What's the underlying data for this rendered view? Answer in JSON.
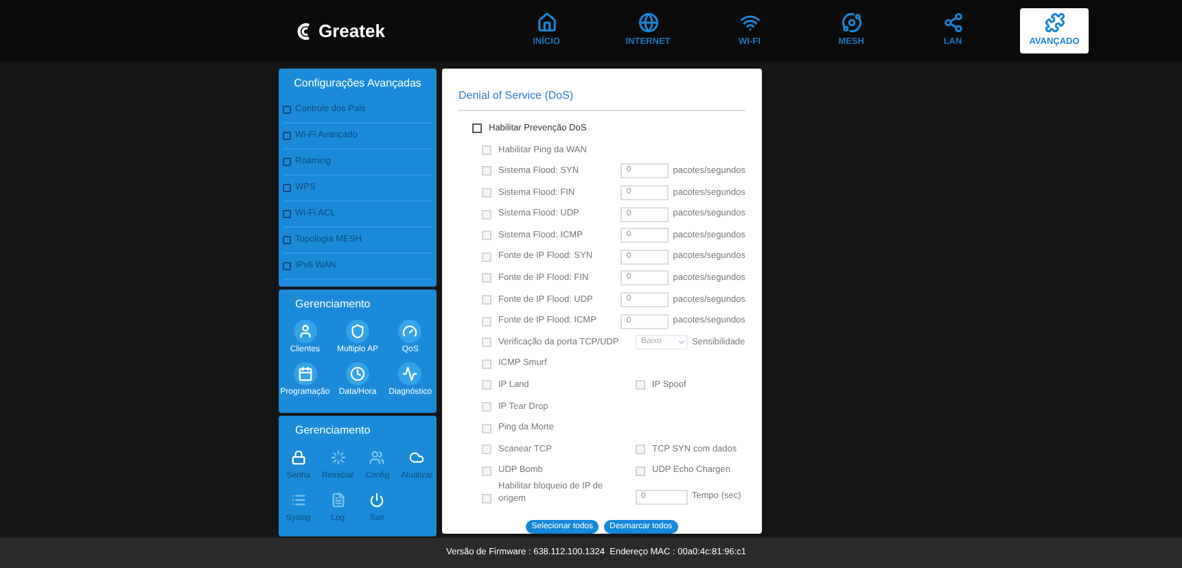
{
  "logo": "Greatek",
  "nav": [
    {
      "label": "INÍCIO",
      "selected": false
    },
    {
      "label": "INTERNET",
      "selected": false
    },
    {
      "label": "WI-FI",
      "selected": false
    },
    {
      "label": "MESH",
      "selected": false
    },
    {
      "label": "LAN",
      "selected": false
    },
    {
      "label": "AVANÇADO",
      "selected": true
    }
  ],
  "advanced_menu": {
    "title": "Configurações Avançadas",
    "items": [
      {
        "label": "Controle dos Pais",
        "disabled": true
      },
      {
        "label": "Wi-Fi Avançado",
        "disabled": true
      },
      {
        "label": "Roaming",
        "disabled": true
      },
      {
        "label": "WPS",
        "disabled": true
      },
      {
        "label": "Wi-Fi ACL",
        "disabled": true
      },
      {
        "label": "Topologia MESH",
        "disabled": true
      },
      {
        "label": "IPv6 WAN",
        "disabled": true
      }
    ]
  },
  "management_panels": [
    {
      "title": "Gerenciamento",
      "items": [
        {
          "label": "Clientes",
          "disabled": false
        },
        {
          "label": "Multiplo AP",
          "disabled": false
        },
        {
          "label": "QoS",
          "disabled": false
        },
        {
          "label": "Programação",
          "disabled": false
        },
        {
          "label": "Data/Hora",
          "disabled": false
        },
        {
          "label": "Diagnóstico",
          "disabled": false
        }
      ]
    },
    {
      "title": "Gerenciamento",
      "items": [
        {
          "label": "Senha",
          "disabled": true
        },
        {
          "label": "Reiniciar",
          "disabled": true
        },
        {
          "label": "Config",
          "disabled": true
        },
        {
          "label": "Atualizar",
          "disabled": true
        },
        {
          "label": "Syslog",
          "disabled": true
        },
        {
          "label": "Log",
          "disabled": true
        },
        {
          "label": "Sair",
          "disabled": true
        }
      ]
    }
  ],
  "dos": {
    "title": "Denial of Service (DoS)",
    "rows": [
      {
        "kind": "check",
        "label": "Habilitar Prevenção DoS",
        "checked": false,
        "disabled": false,
        "indent": false
      },
      {
        "kind": "check",
        "label": "Habilitar Ping da WAN",
        "checked": false,
        "disabled": true,
        "indent": true
      },
      {
        "kind": "rate",
        "label": "Sistema Flood: SYN",
        "checked": false,
        "disabled": true,
        "value": "0",
        "unit": "pacotes/segundos"
      },
      {
        "kind": "rate",
        "label": "Sistema Flood: FIN",
        "checked": false,
        "disabled": true,
        "value": "0",
        "unit": "pacotes/segundos"
      },
      {
        "kind": "rate",
        "label": "Sistema Flood: UDP",
        "checked": false,
        "disabled": true,
        "value": "0",
        "unit": "pacotes/segundos"
      },
      {
        "kind": "rate",
        "label": "Sistema Flood: ICMP",
        "checked": false,
        "disabled": true,
        "value": "0",
        "unit": "pacotes/segundos"
      },
      {
        "kind": "rate",
        "label": "Fonte de IP Flood: SYN",
        "checked": false,
        "disabled": true,
        "value": "0",
        "unit": "pacotes/segundos"
      },
      {
        "kind": "rate",
        "label": "Fonte de IP Flood: FIN",
        "checked": false,
        "disabled": true,
        "value": "0",
        "unit": "pacotes/segundos"
      },
      {
        "kind": "rate",
        "label": "Fonte de IP Flood: UDP",
        "checked": false,
        "disabled": true,
        "value": "0",
        "unit": "pacotes/segundos"
      },
      {
        "kind": "rate",
        "label": "Fonte de IP Flood: ICMP",
        "checked": false,
        "disabled": true,
        "value": "0",
        "unit": "pacotes/segundos"
      },
      {
        "kind": "select",
        "label": "Verificação da porta TCP/UDP",
        "checked": false,
        "disabled": true,
        "value": "Baixo",
        "unit": "Sensibilidade"
      },
      {
        "kind": "check",
        "label": "ICMP Smurf",
        "checked": false,
        "disabled": true,
        "indent": true
      },
      {
        "kind": "pair",
        "label": "IP Land",
        "checked": false,
        "disabled": true,
        "label2": "IP Spoof",
        "checked2": false
      },
      {
        "kind": "check",
        "label": "IP Tear Drop",
        "checked": false,
        "disabled": true,
        "indent": true
      },
      {
        "kind": "check",
        "label": "Ping da Morte",
        "checked": false,
        "disabled": true,
        "indent": true
      },
      {
        "kind": "pair",
        "label": "Scanear TCP",
        "checked": false,
        "disabled": true,
        "label2": "TCP SYN com dados",
        "checked2": false
      },
      {
        "kind": "pair",
        "label": "UDP Bomb",
        "checked": false,
        "disabled": true,
        "label2": "UDP Echo Chargen",
        "checked2": false
      },
      {
        "kind": "timed",
        "label": "Habilitar bloqueio de IP de origem",
        "checked": false,
        "disabled": true,
        "value": "0",
        "unit": "Tempo (sec)"
      }
    ],
    "buttons": [
      "Selecionar todos",
      "Desmarcar todos"
    ]
  },
  "footer": "Versão de Firmware : 638.112.100.1324  Endereço MAC : 00a0:4c:81:96:c1"
}
